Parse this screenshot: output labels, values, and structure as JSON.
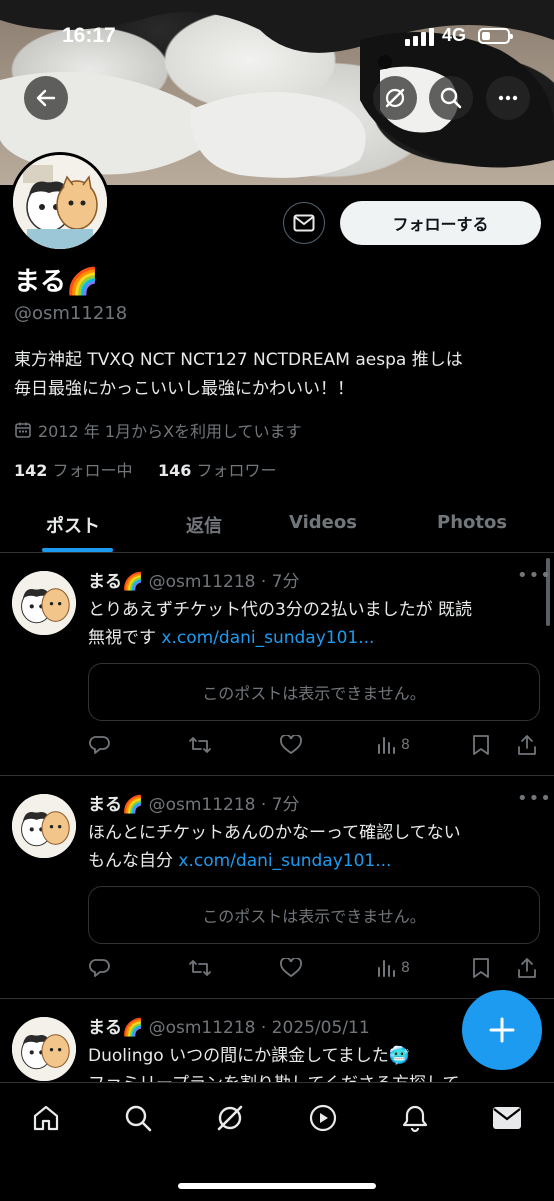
{
  "status_bar": {
    "time": "16:17",
    "network": "4G"
  },
  "profile": {
    "name": "まる",
    "name_emoji": "🌈",
    "handle": "@osm11218",
    "bio_line1": "東方神起 TVXQ NCT NCT127 NCTDREAM aespa 推しは",
    "bio_line2": "毎日最強にかっこいいし最強にかわいい！！",
    "joined": "2012 年 1月からXを利用しています",
    "following_count": "142",
    "following_label": "フォロー中",
    "followers_count": "146",
    "followers_label": "フォロワー",
    "follow_button": "フォローする"
  },
  "tabs": [
    "ポスト",
    "返信",
    "Videos",
    "Photos"
  ],
  "posts": [
    {
      "name": "まる",
      "emoji": "🌈",
      "meta": "@osm11218 · 7分",
      "text_line1": "とりあえずチケット代の3分の2払いましたが 既読",
      "text_line2_prefix": "無視です ",
      "link": "x.com/dani_sunday101...",
      "quote": "このポストは表示できません。",
      "views": "8"
    },
    {
      "name": "まる",
      "emoji": "🌈",
      "meta": "@osm11218 · 7分",
      "text_line1": "ほんとにチケットあんのかなーって確認してない",
      "text_line2_prefix": "もんな自分 ",
      "link": "x.com/dani_sunday101...",
      "quote": "このポストは表示できません。",
      "views": "8"
    },
    {
      "name": "まる",
      "emoji": "🌈",
      "meta": "@osm11218 · 2025/05/11",
      "text_line1": "Duolingo いつの間にか課金してました🥶",
      "text_line2": "ファミリープランを割り勘してくださる方探して"
    }
  ],
  "icons": {
    "back": "arrow-left-icon",
    "grok": "grok-icon",
    "search": "search-icon",
    "more": "more-icon",
    "message": "envelope-icon",
    "calendar": "calendar-icon",
    "compose": "plus-icon"
  },
  "colors": {
    "accent": "#1d9bf0",
    "background": "#000000",
    "muted": "#71767b"
  }
}
